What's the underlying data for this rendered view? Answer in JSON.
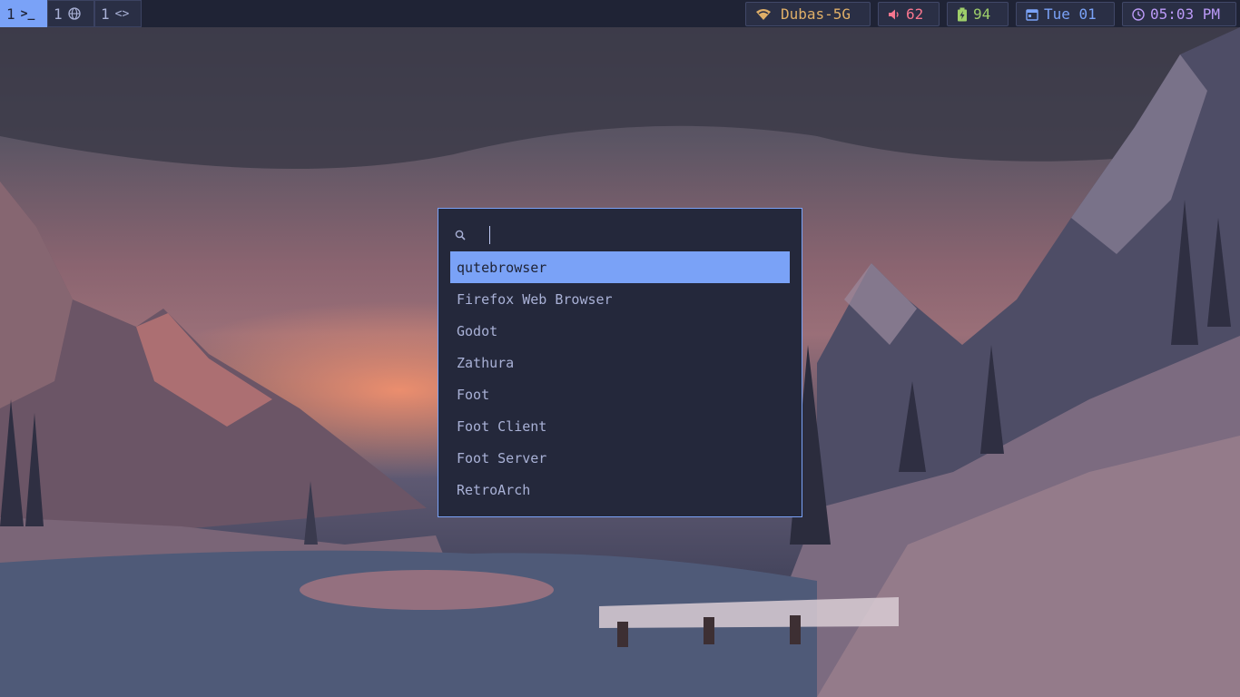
{
  "workspaces": [
    {
      "number": "1",
      "icon": "terminal-icon",
      "glyph": ">_",
      "active": true
    },
    {
      "number": "1",
      "icon": "globe-icon",
      "glyph": "",
      "active": false
    },
    {
      "number": "1",
      "icon": "code-icon",
      "glyph": "<>",
      "active": false
    }
  ],
  "status": {
    "wifi": {
      "label": "Dubas-5G",
      "color": "#e0af68"
    },
    "volume": {
      "label": "62",
      "color": "#f7768e"
    },
    "battery": {
      "label": "94",
      "color": "#9ece6a"
    },
    "date": {
      "label": "Tue 01",
      "color": "#7aa2f7"
    },
    "time": {
      "label": "05:03 PM",
      "color": "#bb9af7"
    }
  },
  "launcher": {
    "search": {
      "value": "",
      "placeholder": ""
    },
    "results": [
      {
        "label": "qutebrowser",
        "selected": true
      },
      {
        "label": "Firefox Web Browser",
        "selected": false
      },
      {
        "label": "Godot",
        "selected": false
      },
      {
        "label": "Zathura",
        "selected": false
      },
      {
        "label": "Foot",
        "selected": false
      },
      {
        "label": "Foot Client",
        "selected": false
      },
      {
        "label": "Foot Server",
        "selected": false
      },
      {
        "label": "RetroArch",
        "selected": false
      }
    ]
  },
  "colors": {
    "accent": "#7aa2f7",
    "bar_bg": "#1f2335",
    "launcher_bg": "#24283b",
    "text": "#a9b1d6"
  }
}
